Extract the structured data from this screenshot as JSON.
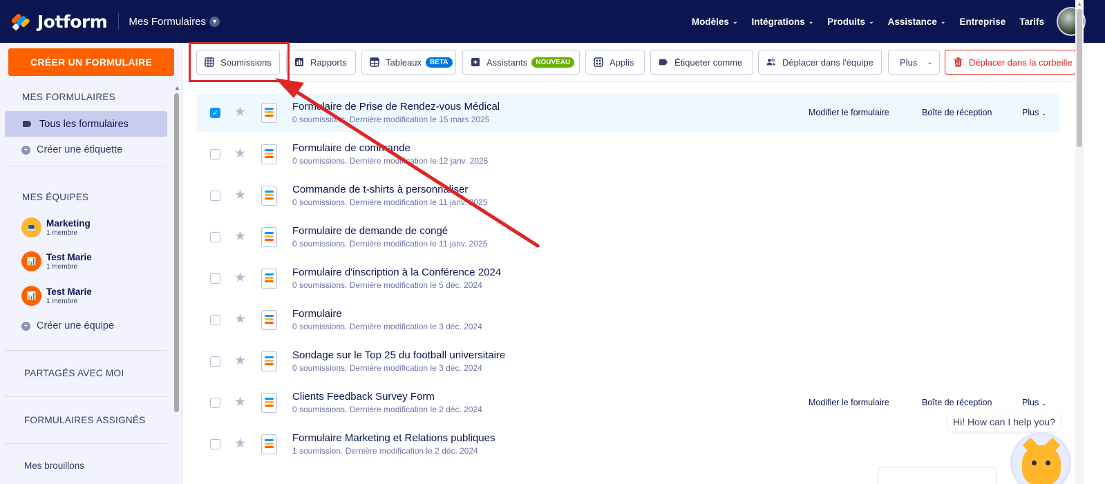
{
  "brand": {
    "name": "Jotform"
  },
  "header": {
    "workspace_label": "Mes Formulaires",
    "nav": [
      "Modèles",
      "Intégrations",
      "Produits",
      "Assistance",
      "Entreprise",
      "Tarifs"
    ]
  },
  "sidebar": {
    "create_label": "CRÉER UN FORMULAIRE",
    "my_forms_heading": "MES FORMULAIRES",
    "all_forms_label": "Tous les formulaires",
    "create_label_link": "Créer une étiquette",
    "my_teams_heading": "MES ÉQUIPES",
    "teams": [
      {
        "name": "Marketing",
        "members": "1 membre"
      },
      {
        "name": "Test Marie",
        "members": "1 membre"
      },
      {
        "name": "Test Marie",
        "members": "1 membre"
      }
    ],
    "create_team_link": "Créer une équipe",
    "shared_heading": "PARTAGÉS AVEC MOI",
    "assigned_heading": "FORMULAIRES ASSIGNÉS",
    "drafts_label": "Mes brouillons"
  },
  "toolbar": {
    "submissions": "Soumissions",
    "reports": "Rapports",
    "tables": "Tableaux",
    "tables_badge": "BETA",
    "assistants": "Assistants",
    "assistants_badge": "NOUVEAU",
    "apps": "Applis",
    "tag_as": "Étiqueter comme",
    "move_team": "Déplacer dans l'équipe",
    "more": "Plus",
    "trash": "Déplacer dans la corbeille"
  },
  "row_actions": {
    "edit": "Modifier le formulaire",
    "inbox": "Boîte de réception",
    "more": "Plus"
  },
  "forms": [
    {
      "title": "Formulaire de Prise de Rendez-vous Médical",
      "meta": "0 soumissions. Dernière modification le 15 mars 2025"
    },
    {
      "title": "Formulaire de commande",
      "meta": "0 soumissions. Dernière modification le 12 janv. 2025"
    },
    {
      "title": "Commande de t-shirts à personnaliser",
      "meta": "0 soumissions. Dernière modification le 11 janv. 2025"
    },
    {
      "title": "Formulaire de demande de congé",
      "meta": "0 soumissions. Dernière modification le 11 janv. 2025"
    },
    {
      "title": "Formulaire d'inscription à la Conférence 2024",
      "meta": "0 soumissions. Dernière modification le 5 déc. 2024"
    },
    {
      "title": "Formulaire",
      "meta": "0 soumissions. Dernière modification le 3 déc. 2024"
    },
    {
      "title": "Sondage sur le Top 25 du football universitaire",
      "meta": "0 soumissions. Dernière modification le 3 déc. 2024"
    },
    {
      "title": "Clients Feedback Survey Form",
      "meta": "0 soumissions. Dernière modification le 2 déc. 2024"
    },
    {
      "title": "Formulaire Marketing et Relations publiques",
      "meta": "1 soumission. Dernière modification le 2 déc. 2024"
    }
  ],
  "chat": {
    "greeting": "Hi! How can I help you?"
  },
  "colors": {
    "nav_bg": "#0a1551",
    "create_btn": "#ff6100",
    "beta_badge": "#0075e3",
    "new_badge": "#64b200",
    "danger": "#dc2626",
    "highlight": "#e02424"
  }
}
